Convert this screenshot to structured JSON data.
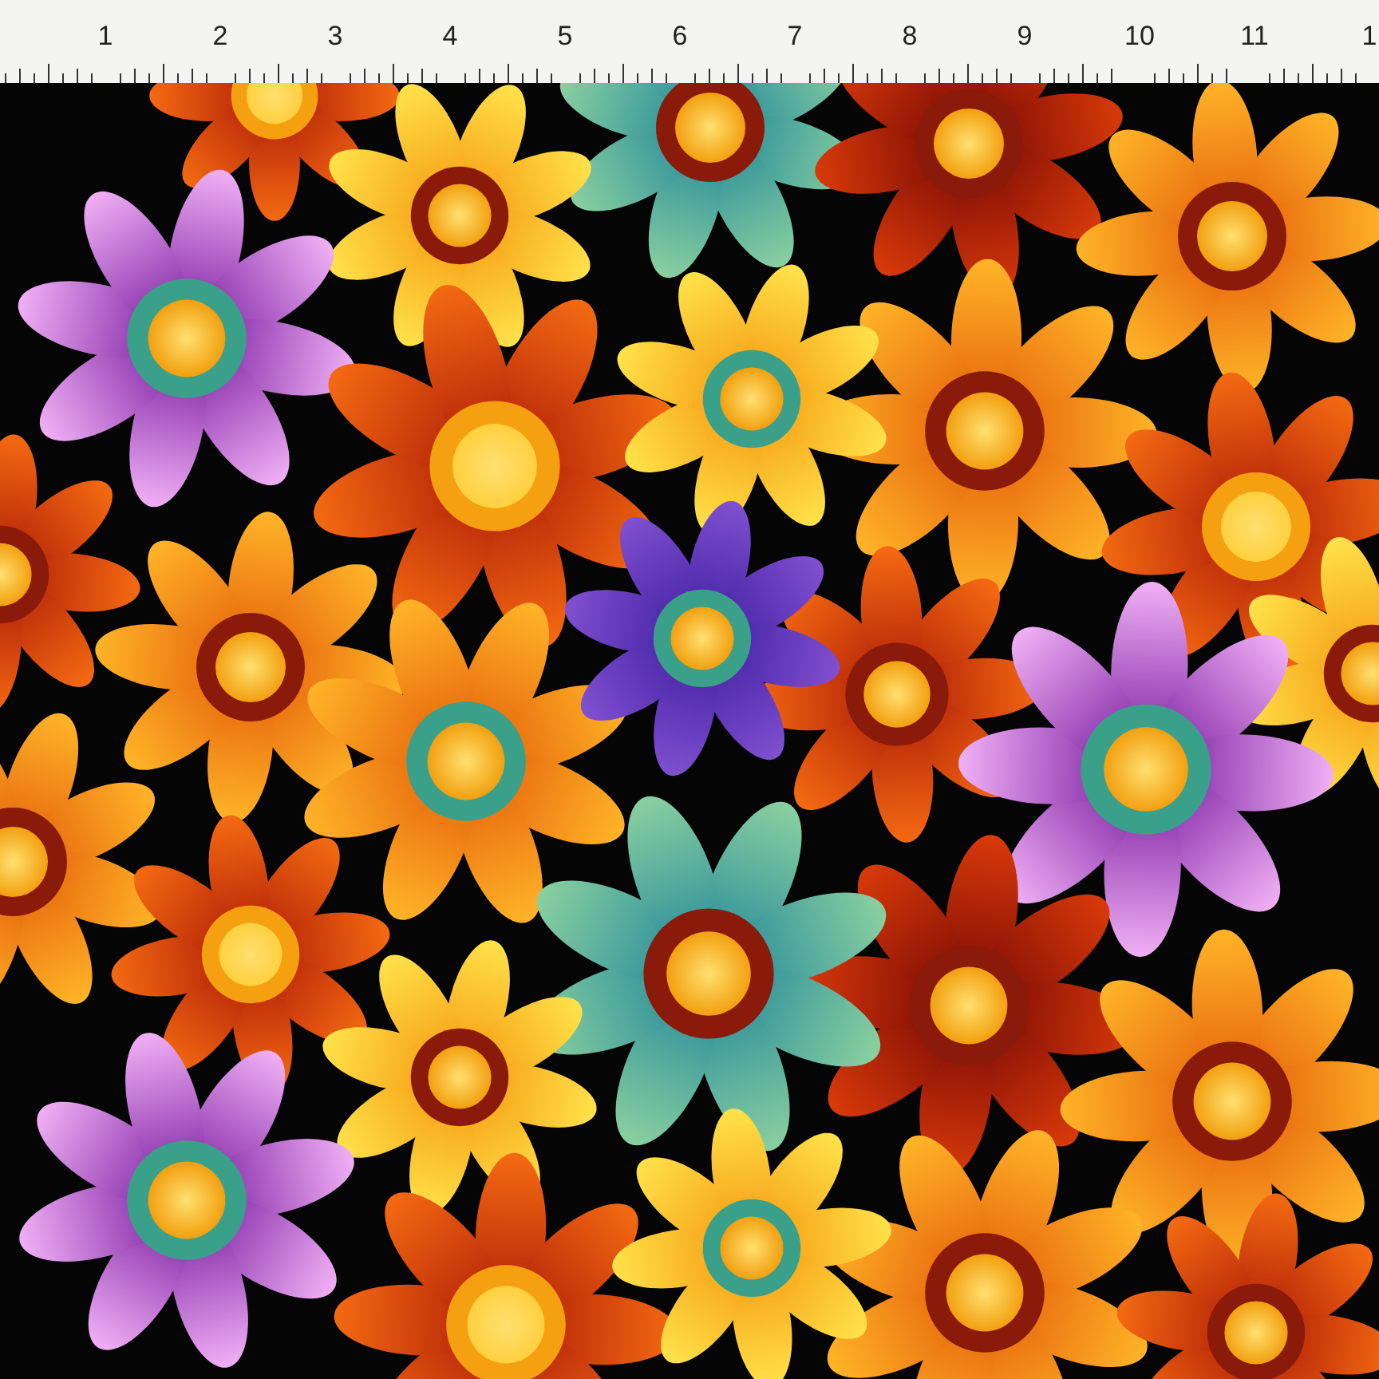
{
  "ruler": {
    "labels": [
      "1",
      "2",
      "3",
      "4",
      "5",
      "6",
      "7",
      "8",
      "9",
      "10",
      "11",
      "1"
    ]
  }
}
